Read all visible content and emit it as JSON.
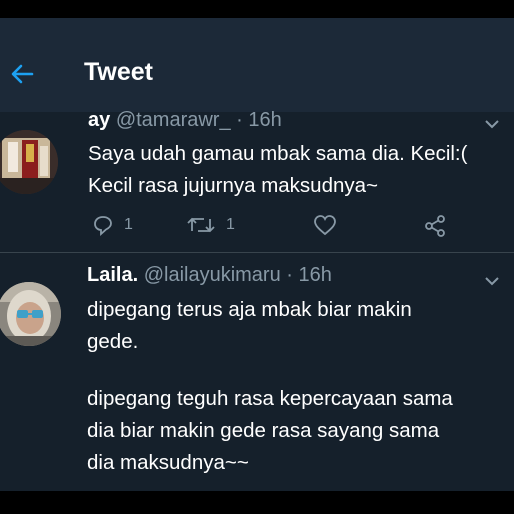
{
  "header": {
    "title": "Tweet",
    "back_icon": "arrow-left-icon",
    "accent": "#1da1f2"
  },
  "tweets": [
    {
      "name": "ay",
      "handle": "@tamarawr_",
      "time": "· 16h",
      "lines": [
        "Saya udah gamau mbak sama dia. Kecil:(",
        "Kecil rasa jujurnya maksudnya~"
      ],
      "actions": {
        "reply_count": "1",
        "retweet_count": "1"
      }
    },
    {
      "name": "Laila.",
      "handle": "@lailayukimaru",
      "time": "· 16h",
      "lines": [
        "dipegang terus aja mbak biar makin",
        "gede.",
        "",
        "dipegang teguh rasa kepercayaan sama",
        "dia biar makin gede rasa sayang sama",
        "dia maksudnya~~"
      ]
    }
  ],
  "colors": {
    "background": "#15202b",
    "topbar": "#1c2938",
    "secondary_text": "#8899a6",
    "divider": "#38444d"
  }
}
